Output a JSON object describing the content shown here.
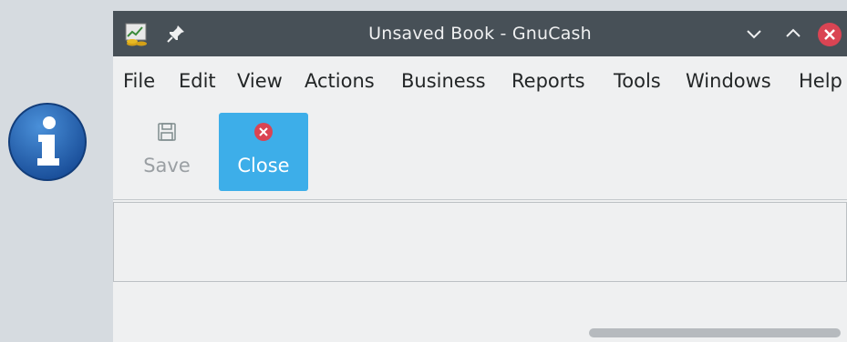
{
  "dialog": {
    "icon": "info-icon"
  },
  "window": {
    "title": "Unsaved Book - GnuCash",
    "app_icon": "gnucash-icon",
    "pin_icon": "pin-icon",
    "controls": {
      "minimize_icon": "chevron-down-icon",
      "maximize_icon": "chevron-up-icon",
      "close_icon": "close-icon"
    }
  },
  "menubar": {
    "items": [
      {
        "label": "File"
      },
      {
        "label": "Edit"
      },
      {
        "label": "View"
      },
      {
        "label": "Actions"
      },
      {
        "label": "Business"
      },
      {
        "label": "Reports"
      },
      {
        "label": "Tools"
      },
      {
        "label": "Windows"
      },
      {
        "label": "Help"
      }
    ]
  },
  "toolbar": {
    "save": {
      "label": "Save",
      "icon": "save-icon",
      "enabled": false
    },
    "close": {
      "label": "Close",
      "icon": "close-circle-icon",
      "active": true
    }
  },
  "colors": {
    "titlebar": "#475057",
    "accent": "#3daee9",
    "close_red": "#da4453",
    "window_bg": "#eff0f1",
    "desktop_bg": "#d6dbe0"
  }
}
